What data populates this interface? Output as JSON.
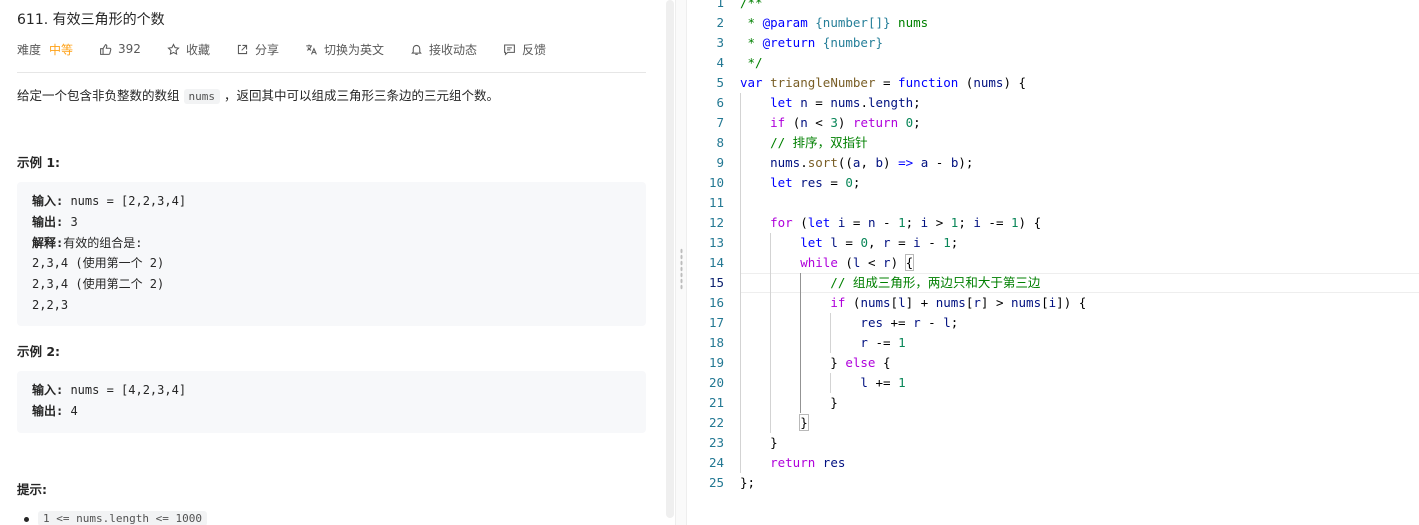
{
  "problem": {
    "title": "611. 有效三角形的个数",
    "meta": {
      "difficulty_label": "难度",
      "difficulty": "中等",
      "likes": "392",
      "favorite": "收藏",
      "share": "分享",
      "switch_lang": "切换为英文",
      "notify": "接收动态",
      "feedback": "反馈"
    },
    "description_before": "给定一个包含非负整数的数组",
    "description_code": "nums",
    "description_after": "，返回其中可以组成三角形三条边的三元组个数。",
    "example1_title": "示例 1:",
    "example1": {
      "input_label": "输入:",
      "input": " nums = [2,2,3,4]",
      "output_label": "输出:",
      "output": " 3",
      "explain_label": "解释:",
      "explain": "有效的组合是:",
      "lines": [
        "2,3,4 (使用第一个 2)",
        "2,3,4 (使用第二个 2)",
        "2,2,3"
      ]
    },
    "example2_title": "示例 2:",
    "example2": {
      "input_label": "输入:",
      "input": " nums = [4,2,3,4]",
      "output_label": "输出:",
      "output": " 4"
    },
    "hints_title": "提示:",
    "hint1": "1 <= nums.length <= 1000"
  },
  "editor": {
    "current_line": 15,
    "line_numbers": [
      "1",
      "2",
      "3",
      "4",
      "5",
      "6",
      "7",
      "8",
      "9",
      "10",
      "11",
      "12",
      "13",
      "14",
      "15",
      "16",
      "17",
      "18",
      "19",
      "20",
      "21",
      "22",
      "23",
      "24",
      "25"
    ],
    "lines": [
      "/**",
      " * @param {number[]} nums",
      " * @return {number}",
      " */",
      "var triangleNumber = function (nums) {",
      "    let n = nums.length;",
      "    if (n < 3) return 0;",
      "    // 排序，双指针",
      "    nums.sort((a, b) => a - b);",
      "    let res = 0;",
      "",
      "    for (let i = n - 1; i > 1; i -= 1) {",
      "        let l = 0, r = i - 1;",
      "        while (l < r) {",
      "            // 组成三角形，两边只和大于第三边",
      "            if (nums[l] + nums[r] > nums[i]) {",
      "                res += r - l;",
      "                r -= 1",
      "            } else {",
      "                l += 1",
      "            }",
      "        }",
      "    }",
      "    return res",
      "};"
    ]
  },
  "icons": {
    "like": "thumbs-up-icon",
    "favorite": "star-icon",
    "share": "share-icon",
    "translate": "translate-icon",
    "bell": "bell-icon",
    "feedback": "comment-icon"
  },
  "colors": {
    "difficulty_medium": "#ffa116",
    "keyword": "#0000ff",
    "control_keyword": "#af00db",
    "comment": "#008000",
    "number": "#098658",
    "function": "#795e26",
    "variable": "#001080",
    "line_number": "#237893"
  }
}
